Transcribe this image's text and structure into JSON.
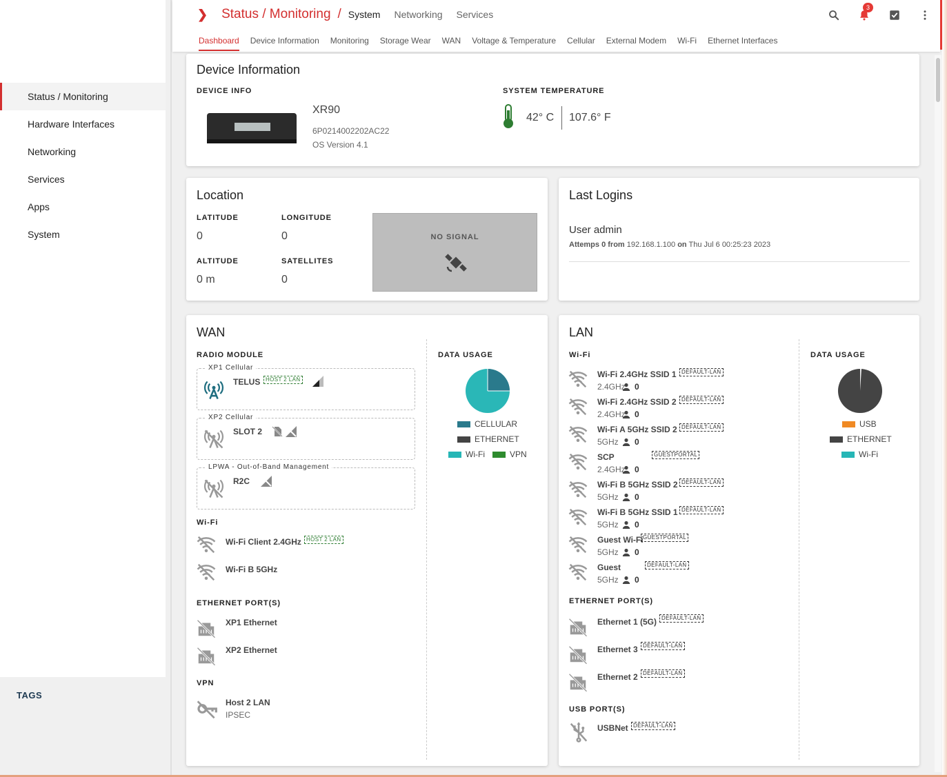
{
  "sidebar": {
    "items": [
      {
        "label": "Status / Monitoring",
        "active": true
      },
      {
        "label": "Hardware Interfaces"
      },
      {
        "label": "Networking"
      },
      {
        "label": "Services"
      },
      {
        "label": "Apps"
      },
      {
        "label": "System"
      }
    ],
    "tags_label": "TAGS"
  },
  "topbar": {
    "breadcrumb_main": "Status / Monitoring",
    "breadcrumb_sep": "/",
    "breadcrumb_current": "System",
    "links": [
      "Networking",
      "Services"
    ],
    "notification_count": "3",
    "accent": "#d32f2f"
  },
  "tabs": [
    "Dashboard",
    "Device Information",
    "Monitoring",
    "Storage Wear",
    "WAN",
    "Voltage & Temperature",
    "Cellular",
    "External Modem",
    "Wi-Fi",
    "Ethernet Interfaces"
  ],
  "device": {
    "title": "Device Information",
    "info_label": "DEVICE INFO",
    "model": "XR90",
    "serial": "6P0214002202AC22",
    "os": "OS Version 4.1",
    "temp_label": "SYSTEM TEMPERATURE",
    "temp_c": "42° C",
    "temp_f": "107.6° F"
  },
  "location": {
    "title": "Location",
    "latitude_label": "LATITUDE",
    "latitude": "0",
    "longitude_label": "LONGITUDE",
    "longitude": "0",
    "altitude_label": "ALTITUDE",
    "altitude": "0 m",
    "satellites_label": "SATELLITES",
    "satellites": "0",
    "no_signal": "NO SIGNAL"
  },
  "logins": {
    "title": "Last Logins",
    "user": "User admin",
    "attempts_label": "Attemps",
    "attempts": "0",
    "from_label": "from",
    "ip": "192.168.1.100",
    "on_label": "on",
    "time": "Thu Jul 6 00:25:23 2023"
  },
  "wan": {
    "title": "WAN",
    "radio_label": "RADIO MODULE",
    "modules": [
      {
        "title": "XP1 Cellular",
        "name": "TELUS",
        "tag": "HOST 2 LAN"
      },
      {
        "title": "XP2 Cellular",
        "name": "SLOT 2"
      },
      {
        "title": "LPWA - Out-of-Band Management",
        "name": "R2C"
      }
    ],
    "wifi_label": "Wi-Fi",
    "wifi": [
      {
        "name": "Wi-Fi Client 2.4GHz",
        "tag": "HOST 2 LAN"
      },
      {
        "name": "Wi-Fi B 5GHz"
      }
    ],
    "eth_label": "ETHERNET PORT(S)",
    "eth": [
      "XP1 Ethernet",
      "XP2 Ethernet"
    ],
    "vpn_label": "VPN",
    "vpn_name": "Host 2 LAN",
    "vpn_sub": "IPSEC",
    "usage_label": "DATA USAGE",
    "legend": [
      {
        "label": "CELLULAR",
        "color": "#2a7a8c"
      },
      {
        "label": "ETHERNET",
        "color": "#444444"
      },
      {
        "label": "Wi-Fi",
        "color": "#26b6b6"
      },
      {
        "label": "VPN",
        "color": "#2e8b2e"
      }
    ]
  },
  "lan": {
    "title": "LAN",
    "wifi_label": "Wi-Fi",
    "wifi": [
      {
        "name": "Wi-Fi 2.4GHz SSID 1",
        "band": "2.4GHz",
        "clients": "0",
        "tag": "DEFAULT-LAN"
      },
      {
        "name": "Wi-Fi 2.4GHz SSID 2",
        "band": "2.4GHz",
        "clients": "0",
        "tag": "DEFAULT-LAN"
      },
      {
        "name": "Wi-Fi A 5GHz SSID 2",
        "band": "5GHz",
        "clients": "0",
        "tag": "DEFAULT-LAN"
      },
      {
        "name": "SCP",
        "band": "2.4GHz",
        "clients": "0",
        "tag": "GUESTPORTAL"
      },
      {
        "name": "Wi-Fi B 5GHz SSID 2",
        "band": "5GHz",
        "clients": "0",
        "tag": "DEFAULT-LAN"
      },
      {
        "name": "Wi-Fi B 5GHz SSID 1",
        "band": "5GHz",
        "clients": "0",
        "tag": "DEFAULT-LAN"
      },
      {
        "name": "Guest Wi-Fi",
        "band": "5GHz",
        "clients": "0",
        "tag": "GUESTPORTAL"
      },
      {
        "name": "Guest",
        "band": "5GHz",
        "clients": "0",
        "tag": "DEFAULT-LAN"
      }
    ],
    "eth_label": "ETHERNET PORT(S)",
    "eth": [
      {
        "name": "Ethernet 1 (5G)",
        "tag": "DEFAULT-LAN"
      },
      {
        "name": "Ethernet 3",
        "tag": "DEFAULT-LAN"
      },
      {
        "name": "Ethernet 2",
        "tag": "DEFAULT-LAN"
      }
    ],
    "usb_label": "USB PORT(S)",
    "usb": {
      "name": "USBNet",
      "tag": "DEFAULT-LAN"
    },
    "usage_label": "DATA USAGE",
    "legend": [
      {
        "label": "USB",
        "color": "#f08a24"
      },
      {
        "label": "ETHERNET",
        "color": "#444444"
      },
      {
        "label": "Wi-Fi",
        "color": "#26b6b6"
      }
    ]
  }
}
